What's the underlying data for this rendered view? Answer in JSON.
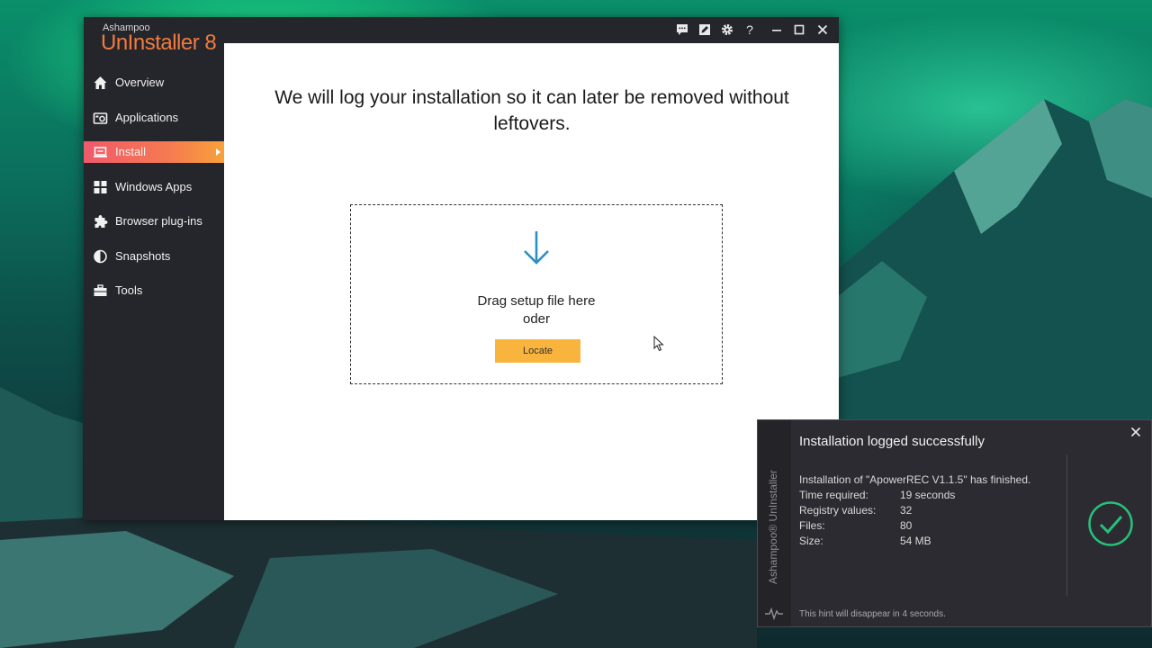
{
  "app": {
    "brand_small": "Ashampoo",
    "brand_name": "UnInstaller 8"
  },
  "titlebar": {
    "icons": [
      "feedback-icon",
      "edit-icon",
      "gear-icon",
      "help-icon",
      "minimize-icon",
      "maximize-icon",
      "close-icon"
    ],
    "help_glyph": "?"
  },
  "sidebar": {
    "items": [
      {
        "label": "Overview",
        "icon": "home-icon"
      },
      {
        "label": "Applications",
        "icon": "applications-icon"
      },
      {
        "label": "Install",
        "icon": "install-icon",
        "active": true
      },
      {
        "label": "Windows Apps",
        "icon": "windows-tiles-icon"
      },
      {
        "label": "Browser plug-ins",
        "icon": "puzzle-icon"
      },
      {
        "label": "Snapshots",
        "icon": "snapshot-icon"
      },
      {
        "label": "Tools",
        "icon": "toolbox-icon"
      }
    ]
  },
  "main": {
    "headline": "We will log your installation so it can later be removed without leftovers.",
    "drop_text": "Drag setup file here",
    "drop_or": "oder",
    "locate_label": "Locate"
  },
  "toast": {
    "rail_label": "Ashampoo® UnInstaller",
    "title": "Installation logged successfully",
    "message": "Installation of \"ApowerREC V1.1.5\" has finished.",
    "stats": [
      {
        "key": "Time required:",
        "value": "19 seconds"
      },
      {
        "key": "Registry values:",
        "value": "32"
      },
      {
        "key": "Files:",
        "value": "80"
      },
      {
        "key": "Size:",
        "value": "54 MB"
      }
    ],
    "hint": "This hint will disappear in 4 seconds."
  },
  "colors": {
    "accent_orange": "#f9b43d",
    "brand_orange": "#f07b3f",
    "sidebar_bg": "#25252c",
    "success_green": "#27c07a",
    "arrow_blue": "#2c8fc4"
  }
}
